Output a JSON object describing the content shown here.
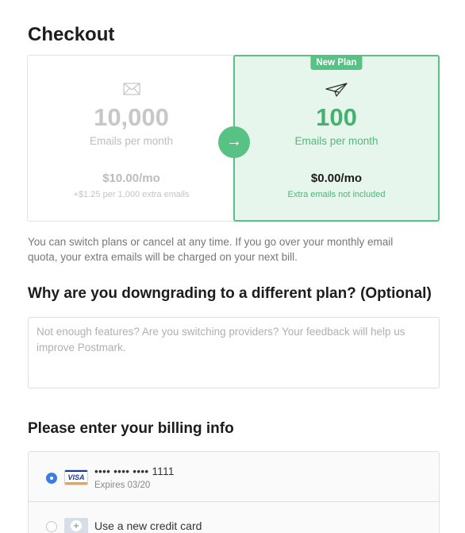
{
  "page": {
    "title": "Checkout"
  },
  "current_plan": {
    "icon": "envelope-icon",
    "emails": "10,000",
    "unit": "Emails per month",
    "price": "$10.00/mo",
    "price_note": "+$1.25 per 1,000 extra emails"
  },
  "switch": {
    "arrow": "→",
    "icon": "arrow-right-icon"
  },
  "new_plan": {
    "badge": "New Plan",
    "icon": "paper-plane-icon",
    "emails": "100",
    "unit": "Emails per month",
    "price": "$0.00/mo",
    "price_note": "Extra emails not included"
  },
  "info": {
    "text": "You can switch plans or cancel at any time. If you go over your monthly email quota, your extra emails will be charged on your next bill."
  },
  "feedback": {
    "heading": "Why are you downgrading to a different plan? (Optional)",
    "placeholder": "Not enough features? Are you switching providers? Your feedback will help us improve Postmark.",
    "value": ""
  },
  "billing": {
    "heading": "Please enter your billing info",
    "saved_card": {
      "brand": "VISA",
      "number": "•••• •••• •••• 1111",
      "expires": "Expires 03/20",
      "selected": true
    },
    "new_card": {
      "icon": "plus-icon",
      "plus": "+",
      "label": "Use a new credit card",
      "selected": false
    }
  },
  "colors": {
    "accent_green": "#58c285",
    "radio_blue": "#3b7de0"
  }
}
